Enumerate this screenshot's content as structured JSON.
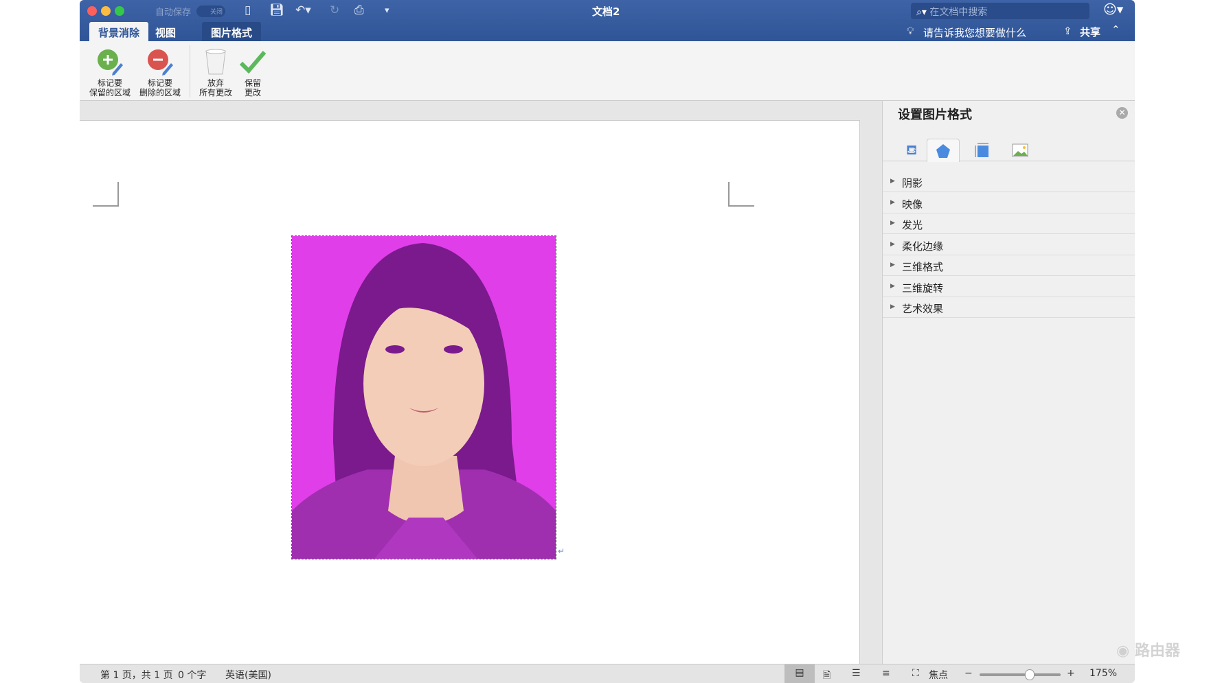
{
  "title": "文档2",
  "autosave": {
    "label": "自动保存",
    "toggle": "关闭"
  },
  "tabs": [
    "背景消除",
    "视图",
    "图片格式"
  ],
  "search": {
    "placeholder": "在文档中搜索"
  },
  "tell_me": "请告诉我您想要做什么",
  "share": "共享",
  "ribbon": [
    {
      "l1": "标记要",
      "l2": "保留的区域"
    },
    {
      "l1": "标记要",
      "l2": "删除的区域"
    },
    {
      "l1": "放弃",
      "l2": "所有更改"
    },
    {
      "l1": "保留",
      "l2": "更改"
    }
  ],
  "pane": {
    "title": "设置图片格式",
    "sections": [
      "阴影",
      "映像",
      "发光",
      "柔化边缘",
      "三维格式",
      "三维旋转",
      "艺术效果"
    ]
  },
  "status": {
    "page": "第 1 页，共 1 页",
    "words": "0 个字",
    "lang": "英语(美国)",
    "focus": "焦点",
    "zoom": "175%"
  },
  "colors": {
    "titlebar": "#2f5597",
    "photo_bg": "#e03ee8",
    "hair": "#7a1a8c"
  },
  "watermark": "路由器 luyouqi.com"
}
